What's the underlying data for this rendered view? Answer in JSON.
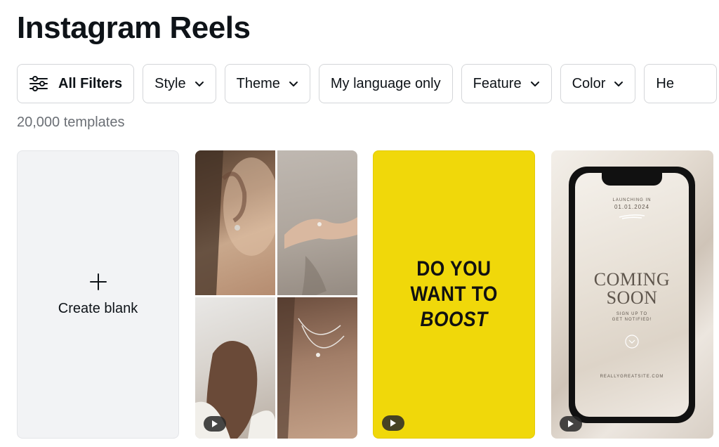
{
  "page": {
    "title": "Instagram Reels"
  },
  "filters": [
    {
      "label": "All Filters",
      "icon": "sliders-icon"
    },
    {
      "label": "Style",
      "icon": "chevron-down-icon"
    },
    {
      "label": "Theme",
      "icon": "chevron-down-icon"
    },
    {
      "label": "My language only"
    },
    {
      "label": "Feature",
      "icon": "chevron-down-icon"
    },
    {
      "label": "Color",
      "icon": "chevron-down-icon"
    },
    {
      "label": "He"
    }
  ],
  "template_count": "20,000 templates",
  "cards": {
    "blank": {
      "label": "Create blank",
      "icon": "plus-icon"
    },
    "boost": {
      "line1": "DO YOU",
      "line2": "WANT TO",
      "line3": "BOOST",
      "bg": "#f0d80a"
    },
    "coming_soon": {
      "launching": "LAUNCHING IN",
      "date": "01.01.2024",
      "heading1": "COMING",
      "heading2": "SOON",
      "sub1": "SIGN UP TO",
      "sub2": "GET NOTIFIED!",
      "site": "REALLYGREATSITE.COM"
    }
  },
  "icons": {
    "video_badge": "play-icon"
  }
}
